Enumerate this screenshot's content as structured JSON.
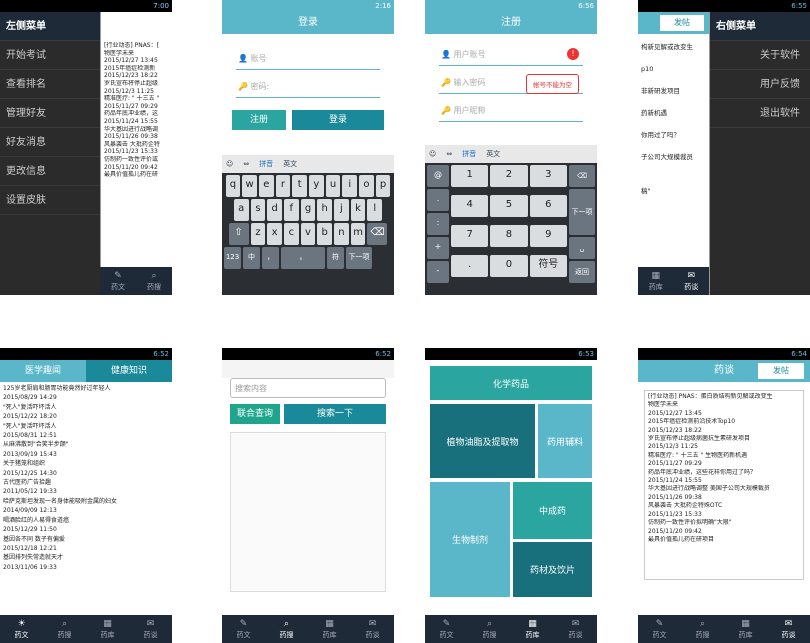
{
  "screens": {
    "s1": {
      "time": "7:00",
      "title": "左侧菜单",
      "menu": [
        "开始考试",
        "查看排名",
        "管理好友",
        "好友消息",
        "更改信息",
        "设置皮肤"
      ],
      "peek": [
        "[行业动态] PNAS：[",
        "物医学未来",
        "2015/12/27 13:45",
        "2015年癌症检测新",
        "2015/12/23 18:22",
        "罗氏宣布将停止超级",
        "2015/12/3 11:25",
        "精准医疗: \" 十三五 \"",
        "2015/11/27 09:29",
        "药品年底冲业绩，这",
        "2015/11/24 15:55",
        "华大基因进行战略调",
        "2015/11/26 09:38",
        "风暴袭击 大批药企特",
        "2015/11/23 15:33",
        "仿制药一致性评价或",
        "2015/11/20 09:42",
        "最具价值孤儿药在研"
      ],
      "tabs": [
        "药文",
        "药搜"
      ]
    },
    "s2": {
      "time": "2:16",
      "title": "登录",
      "account": "账号",
      "password": "密码:",
      "register": "注册",
      "login": "登录",
      "ime": [
        "拼音",
        "英文"
      ],
      "rows": [
        [
          "q",
          "w",
          "e",
          "r",
          "t",
          "y",
          "u",
          "i",
          "o",
          "p"
        ],
        [
          "a",
          "s",
          "d",
          "f",
          "g",
          "h",
          "j",
          "k",
          "l"
        ],
        [
          "z",
          "x",
          "c",
          "v",
          "b",
          "n",
          "m"
        ]
      ],
      "bottom": [
        "123",
        "中",
        "，",
        "。",
        "符",
        "下一项"
      ]
    },
    "s3": {
      "time": "6:56",
      "title": "注册",
      "fields": [
        "用户账号",
        "输入密码",
        "用户昵称"
      ],
      "error": "帐号不能为空",
      "ime": [
        "拼音",
        "英文"
      ],
      "side": [
        "@",
        ".",
        ":",
        "+",
        "-"
      ],
      "nums": [
        "1",
        "2",
        "3",
        "4",
        "5",
        "6",
        "7",
        "8",
        "9",
        ".",
        "0",
        "符号"
      ],
      "right": [
        "⌫",
        "下一项",
        "␣",
        "返回"
      ]
    },
    "s4": {
      "time": "6:55",
      "title": "右侧菜单",
      "post": "发帖",
      "menu": [
        "关于软件",
        "用户反馈",
        "退出软件"
      ],
      "peek": [
        "构新见解或改变生",
        "p10",
        "非新研发项目",
        "药新机遇",
        "你用过了吗？",
        "子公司大规模裁员",
        "稿\""
      ],
      "tabs": [
        "药库",
        "药谈"
      ]
    },
    "s5": {
      "time": "6:52",
      "tabs_top": [
        "医学趣闻",
        "健康知识"
      ],
      "items": [
        "125岁老厨肩和肠胃功能竟然好过年轻人",
        "2015/08/29 14:29",
        "\"死人\"复活吓坏活人",
        "2015/12/22 18:20",
        "\"死人\"复活吓坏活人",
        "2015/08/31 12:51",
        "从麻沸散到\"合笑半步颠\"",
        "2013/09/19 15:43",
        "关于猪笼和组织",
        "2015/12/25 14:30",
        "古代医药广告拾趣",
        "2011/05/12 19:33",
        "哈萨克斯坦发现一名身体能吸附金属的妇女",
        "2014/09/09 12:13",
        "喝酒脸红的人易得食道癌",
        "2015/12/29 11:50",
        "基因各不同 数子有偏爱",
        "2015/12/18 12:21",
        "基因排列失常造就天才",
        "2013/11/06 19:33"
      ],
      "tabs": [
        "药文",
        "药搜",
        "药库",
        "药谈"
      ]
    },
    "s6": {
      "time": "6:52",
      "placeholder": "搜索内容",
      "btn1": "联合查询",
      "btn2": "搜索一下",
      "tabs": [
        "药文",
        "药搜",
        "药库",
        "药谈"
      ]
    },
    "s7": {
      "time": "6:53",
      "tiles": [
        "化学药品",
        "植物油脂及提取物",
        "药用辅料",
        "中成药",
        "生物制剂",
        "药材及饮片"
      ],
      "tabs": [
        "药文",
        "药搜",
        "药库",
        "药谈"
      ]
    },
    "s8": {
      "time": "6:54",
      "title": "药谈",
      "post": "发帖",
      "items": [
        "[行业动态] PNAS：蛋白质结构新见解或改变生",
        "物医学未来",
        "2015/12/27 13:45",
        "2015年癌症检测前沿技术Top10",
        "2015/12/23 18:22",
        "罗氏宣布停止超级病菌抗生素研发项目",
        "2015/12/3 11:25",
        "精准医疗: \" 十三五 \" 生物医药新机遇",
        "2015/11/27 09:29",
        "药品年底冲业绩，这些花样你用过了吗？",
        "2015/11/24 15:55",
        "华大基因进行战略调整 美国子公司大规模裁员",
        "2015/11/26 09:38",
        "风暴袭击 大批药企特殊OTC",
        "2015/11/23 15:33",
        "仿制药一致性评价拟明确\"大限\"",
        "2015/11/20 09:42",
        "最具价值孤儿药在研项目"
      ],
      "tabs": [
        "药文",
        "药搜",
        "药库",
        "药谈"
      ]
    }
  },
  "colors": {
    "teal": "#5ab6c9",
    "dark_teal": "#1a8a9a",
    "nav": "#1e2a38"
  }
}
